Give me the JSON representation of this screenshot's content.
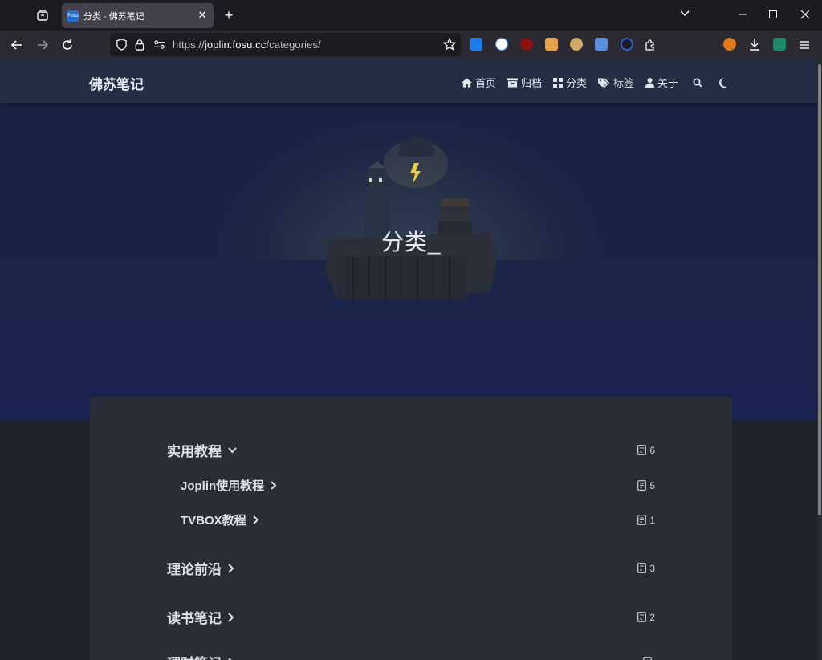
{
  "browser": {
    "tab": {
      "favicon_text": "Fosu",
      "title": "分类 - 佛苏笔记",
      "close": "✕"
    },
    "new_tab": "+",
    "url": {
      "prefix": "https://",
      "domain": "joplin.fosu.cc",
      "path": "/categories/"
    },
    "window": {
      "minimize": "—",
      "maximize": "☐",
      "close": "✕",
      "list_all": "⌄"
    }
  },
  "site": {
    "brand": "佛苏笔记",
    "menu": [
      {
        "icon": "home-icon",
        "label": "首页"
      },
      {
        "icon": "archive-icon",
        "label": "归档"
      },
      {
        "icon": "grid-icon",
        "label": "分类"
      },
      {
        "icon": "tags-icon",
        "label": "标签"
      },
      {
        "icon": "user-icon",
        "label": "关于"
      }
    ],
    "hero_title": "分类_"
  },
  "categories": [
    {
      "name": "实用教程",
      "count": "6",
      "arrow": "⌄"
    },
    {
      "name": "Joplin使用教程",
      "count": "5",
      "arrow": "›"
    },
    {
      "name": "TVBOX教程",
      "count": "1",
      "arrow": "›"
    },
    {
      "name": "理论前沿",
      "count": "3",
      "arrow": "›"
    },
    {
      "name": "读书笔记",
      "count": "2",
      "arrow": "›"
    },
    {
      "name": "理财笔记",
      "count": "",
      "arrow": "›"
    }
  ],
  "colors": {
    "accent": "#1f6fd6",
    "page_bg": "#1f232b",
    "card_bg": "#282d38"
  }
}
